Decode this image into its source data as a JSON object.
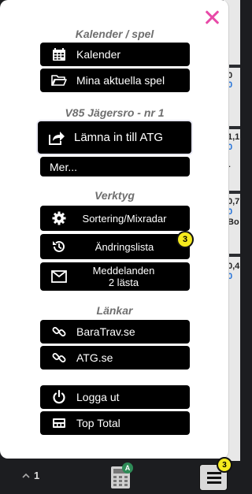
{
  "menu": {
    "sections": {
      "calendar_title": "Kalender / spel",
      "race_title": "V85 Jägersro - nr 1",
      "tools_title": "Verktyg",
      "links_title": "Länkar"
    },
    "buttons": {
      "calendar": "Kalender",
      "my_games": "Mina aktuella spel",
      "submit": "Lämna in till ATG",
      "more": "Mer...",
      "sorting": "Sortering/Mixradar",
      "changes": "Ändringslista",
      "messages_line1": "Meddelanden",
      "messages_line2": "2 lästa",
      "baratrav": "BaraTrav.se",
      "atg": "ATG.se",
      "logout": "Logga ut",
      "top_total": "Top Total"
    },
    "badges": {
      "changes_count": "3"
    }
  },
  "bottom_bar": {
    "page_number": "1",
    "calc_badge": "A",
    "menu_badge": "3"
  },
  "background": {
    "values": [
      "0",
      "0",
      "1,1",
      "0",
      "-",
      "0,7",
      "Bo",
      "0",
      "0,4",
      "0"
    ]
  },
  "colors": {
    "close": "#e84aa8",
    "badge": "#f5ea1e",
    "button": "#000000",
    "section_title": "#6f6f6f"
  }
}
